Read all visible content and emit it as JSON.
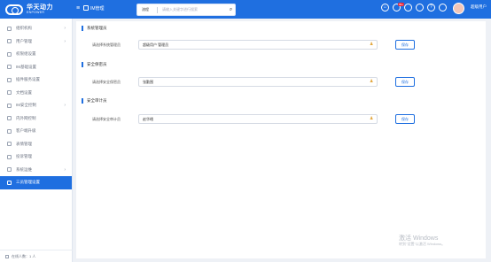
{
  "header": {
    "logo_cn": "华天动力",
    "logo_en": "ENPOWER",
    "app_title": "IM管理",
    "search": {
      "scope": "流程",
      "placeholder": "请输入关键字进行搜索"
    },
    "notification_count": "99+",
    "username": "超级用户"
  },
  "sidebar": {
    "items": [
      {
        "label": "组织机构",
        "has_children": true,
        "active": false
      },
      {
        "label": "用户管理",
        "has_children": true,
        "active": false
      },
      {
        "label": "权限组设置",
        "has_children": false,
        "active": false
      },
      {
        "label": "IM基础设置",
        "has_children": false,
        "active": false
      },
      {
        "label": "插件服务设置",
        "has_children": false,
        "active": false
      },
      {
        "label": "文档设置",
        "has_children": false,
        "active": false
      },
      {
        "label": "IM安全控制",
        "has_children": true,
        "active": false
      },
      {
        "label": "内外网控制",
        "has_children": false,
        "active": false
      },
      {
        "label": "客户端升级",
        "has_children": false,
        "active": false
      },
      {
        "label": "表情管理",
        "has_children": false,
        "active": false
      },
      {
        "label": "投诉管理",
        "has_children": false,
        "active": false
      },
      {
        "label": "系统运维",
        "has_children": true,
        "active": false
      },
      {
        "label": "三员管理设置",
        "has_children": false,
        "active": true
      }
    ],
    "footer": "在线人数：1 人"
  },
  "main": {
    "sections": [
      {
        "title": "系统管理员",
        "row_label": "请选择系统管理员",
        "value": "超级用户    管理员",
        "save_label": "保存"
      },
      {
        "title": "安全保密员",
        "row_label": "请选择安全保密员",
        "value": "张勤围",
        "save_label": "保存"
      },
      {
        "title": "安全审计员",
        "row_label": "请选择安全审计员",
        "value": "赵华峨",
        "save_label": "保存"
      }
    ]
  },
  "watermark": {
    "line1": "激活 Windows",
    "line2": "转到\"设置\"以激活 Windows。"
  },
  "colors": {
    "brand": "#1f6fe0",
    "active_bg": "#1f6fe0",
    "pick_icon": "#e2a53a"
  }
}
